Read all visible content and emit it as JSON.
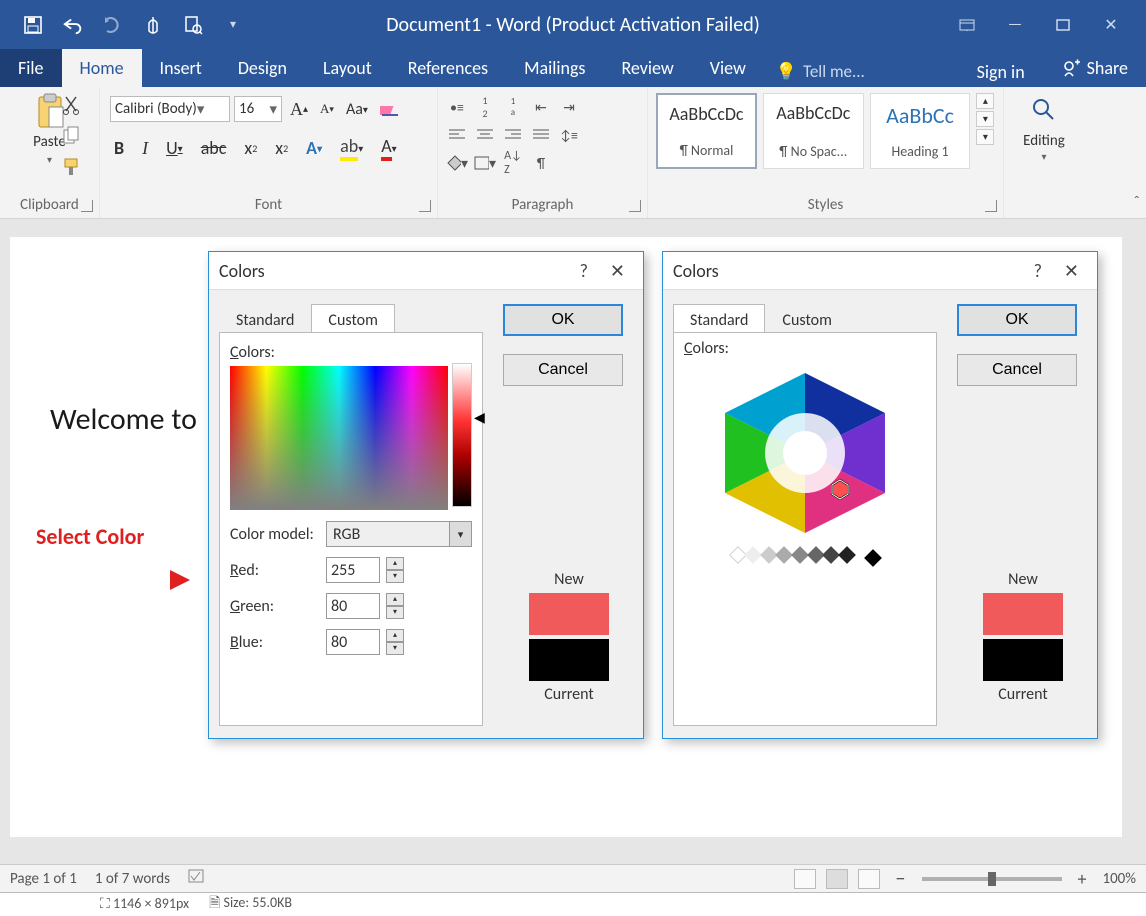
{
  "title_bar": {
    "title": "Document1 - Word (Product Activation Failed)"
  },
  "ribbon": {
    "file": "File",
    "tabs": [
      "Home",
      "Insert",
      "Design",
      "Layout",
      "References",
      "Mailings",
      "Review",
      "View"
    ],
    "active": "Home",
    "tell_me": "Tell me...",
    "sign_in": "Sign in",
    "share": "Share"
  },
  "clipboard": {
    "paste": "Paste",
    "group_label": "Clipboard"
  },
  "font": {
    "name": "Calibri (Body)",
    "size": "16",
    "case_label": "Aa",
    "group_label": "Font",
    "bold": "B",
    "italic": "I",
    "underline": "U",
    "strike": "abc",
    "sub": "x",
    "sup": "x",
    "text_effects": "A",
    "highlight": "ab",
    "font_color": "A"
  },
  "paragraph": {
    "group_label": "Paragraph"
  },
  "styles": {
    "group_label": "Styles",
    "cards": [
      {
        "preview": "AaBbCcDc",
        "name": "¶ Normal"
      },
      {
        "preview": "AaBbCcDc",
        "name": "¶ No Spac..."
      },
      {
        "preview": "AaBbCc",
        "name": "Heading 1"
      }
    ]
  },
  "editing": {
    "label": "Editing"
  },
  "document": {
    "text": "Welcome to",
    "annotation": "Select Color"
  },
  "dialog1": {
    "title": "Colors",
    "tabs": {
      "standard": "Standard",
      "custom": "Custom"
    },
    "active": "Custom",
    "ok": "OK",
    "cancel": "Cancel",
    "colors_label": "Colors:",
    "color_model_label": "Color model:",
    "color_model_value": "RGB",
    "red_label": "Red:",
    "red": "255",
    "green_label": "Green:",
    "green": "80",
    "blue_label": "Blue:",
    "blue": "80",
    "new": "New",
    "current": "Current"
  },
  "dialog2": {
    "title": "Colors",
    "tabs": {
      "standard": "Standard",
      "custom": "Custom"
    },
    "active": "Standard",
    "ok": "OK",
    "cancel": "Cancel",
    "colors_label": "Colors:",
    "new": "New",
    "current": "Current"
  },
  "status_bar": {
    "page": "Page 1 of 1",
    "words": "1 of 7 words",
    "zoom": "100%",
    "minus": "−",
    "plus": "+"
  },
  "host_strip": {
    "dims": "1146 × 891px",
    "size": "Size: 55.0KB"
  },
  "colors": {
    "accent": "#2b579a",
    "new_swatch": "#f15a5a",
    "current_swatch": "#000000"
  }
}
